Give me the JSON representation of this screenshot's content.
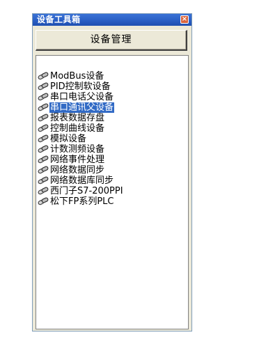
{
  "window": {
    "title": "设备工具箱",
    "close_glyph": "×"
  },
  "manager_button": {
    "label": "设备管理"
  },
  "device_list": {
    "selected_index": 3,
    "items": [
      {
        "label": "ModBus设备",
        "icon": "link-icon"
      },
      {
        "label": "PID控制软设备",
        "icon": "link-icon"
      },
      {
        "label": "串口电话父设备",
        "icon": "link-icon"
      },
      {
        "label": "串口通讯父设备",
        "icon": "link-icon"
      },
      {
        "label": "报表数据存盘",
        "icon": "link-icon"
      },
      {
        "label": "控制曲线设备",
        "icon": "link-icon"
      },
      {
        "label": "模拟设备",
        "icon": "link-icon"
      },
      {
        "label": "计数测频设备",
        "icon": "link-icon"
      },
      {
        "label": "网络事件处理",
        "icon": "link-icon"
      },
      {
        "label": "网络数据同步",
        "icon": "link-icon"
      },
      {
        "label": "网络数据库同步",
        "icon": "link-icon"
      },
      {
        "label": "西门子S7-200PPI",
        "icon": "link-icon"
      },
      {
        "label": "松下FP系列PLC",
        "icon": "link-icon"
      }
    ]
  },
  "colors": {
    "titlebar": "#2a5fc4",
    "selection": "#316ac5",
    "close_button": "#d9663e"
  }
}
